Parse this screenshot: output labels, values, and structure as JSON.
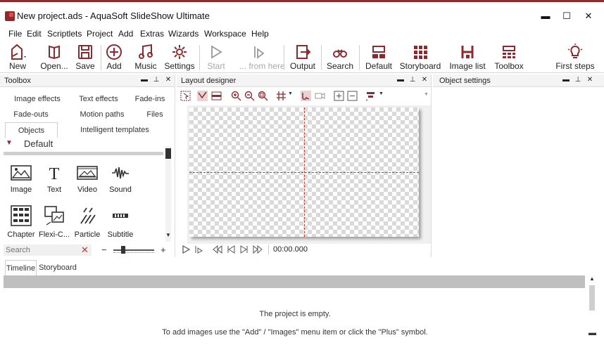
{
  "window": {
    "title": "New project.ads - AquaSoft SlideShow Ultimate",
    "minimize": "▬",
    "maximize": "☐",
    "close": "✕"
  },
  "menu": [
    "File",
    "Edit",
    "Scriptlets",
    "Project",
    "Add",
    "Extras",
    "Wizards",
    "Workspace",
    "Help"
  ],
  "toolbar": {
    "new": "New",
    "open": "Open...",
    "save": "Save",
    "add": "Add",
    "music": "Music",
    "settings": "Settings",
    "start": "Start",
    "from_here": "... from here",
    "output": "Output",
    "search": "Search",
    "default": "Default",
    "storyboard": "Storyboard",
    "image_list": "Image list",
    "toolbox": "Toolbox",
    "first_steps": "First steps"
  },
  "toolbox": {
    "title": "Toolbox",
    "tabs": [
      "Image effects",
      "Text effects",
      "Fade-ins",
      "Fade-outs",
      "Motion paths",
      "Files",
      "Objects",
      "Intelligent templates"
    ],
    "active_tab": "Objects",
    "group": "Default",
    "objects": [
      "Image",
      "Text",
      "Video",
      "Sound",
      "Chapter",
      "Flexi-C...",
      "Particle",
      "Subtitle"
    ],
    "search_placeholder": "Search"
  },
  "layout_designer": {
    "title": "Layout designer",
    "timecode": "00:00.000"
  },
  "object_settings": {
    "title": "Object settings"
  },
  "bottom": {
    "tabs": [
      "Timeline",
      "Storyboard"
    ],
    "active_tab": "Timeline",
    "empty_title": "The project is empty.",
    "empty_hint": "To add images use the \"Add\" / \"Images\" menu item or click the \"Plus\" symbol."
  },
  "colors": {
    "accent": "#8b2b2f",
    "guide": "#c0392b"
  }
}
